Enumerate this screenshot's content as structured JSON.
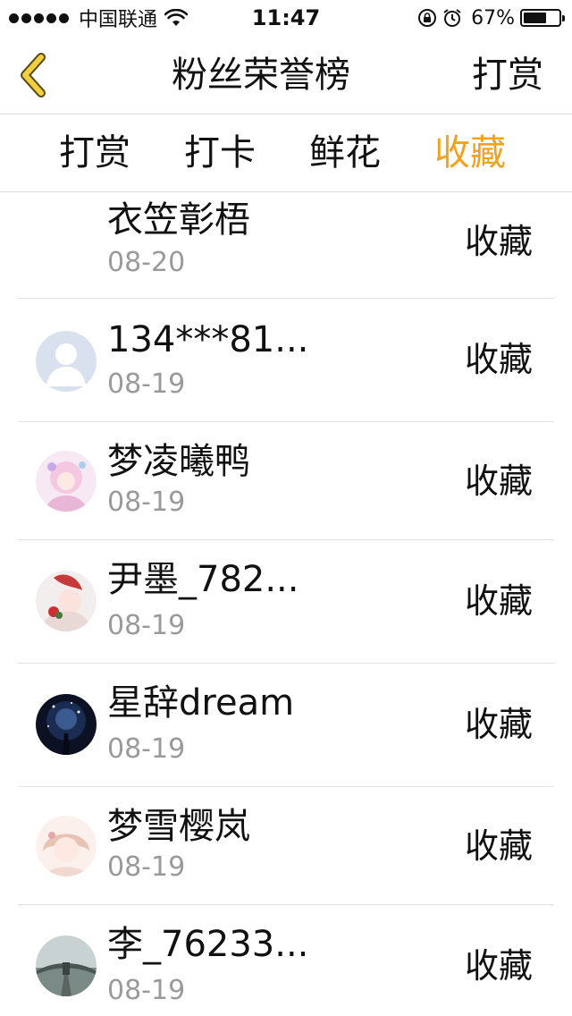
{
  "status_bar": {
    "carrier": "中国联通",
    "time": "11:47",
    "battery_percent": "67%",
    "battery_level": 0.67,
    "icons": [
      "signal-dots-icon",
      "wifi-icon",
      "rotation-lock-icon",
      "alarm-icon",
      "battery-icon"
    ]
  },
  "nav": {
    "back_icon": "chevron-left-icon",
    "title": "粉丝荣誉榜",
    "action": "打赏",
    "back_color": "#f0c020"
  },
  "tabs": [
    {
      "label": "打赏",
      "active": false
    },
    {
      "label": "打卡",
      "active": false
    },
    {
      "label": "鲜花",
      "active": false
    },
    {
      "label": "收藏",
      "active": true
    }
  ],
  "accent_color": "#f0a220",
  "list": [
    {
      "name": "衣笠彰梧",
      "date": "08-20",
      "action": "收藏",
      "avatar": "none"
    },
    {
      "name": "134***81...",
      "date": "08-19",
      "action": "收藏",
      "avatar": "default-user-icon"
    },
    {
      "name": "梦凌曦鸭",
      "date": "08-19",
      "action": "收藏",
      "avatar": "anime-girl-pink-avatar"
    },
    {
      "name": "尹墨_782...",
      "date": "08-19",
      "action": "收藏",
      "avatar": "anime-character-red-avatar"
    },
    {
      "name": "星辞dream",
      "date": "08-19",
      "action": "收藏",
      "avatar": "night-sky-avatar"
    },
    {
      "name": "梦雪樱岚",
      "date": "08-19",
      "action": "收藏",
      "avatar": "anime-girl-pastel-avatar"
    },
    {
      "name": "李_76233...",
      "date": "08-19",
      "action": "收藏",
      "avatar": "bridge-landscape-avatar"
    }
  ]
}
